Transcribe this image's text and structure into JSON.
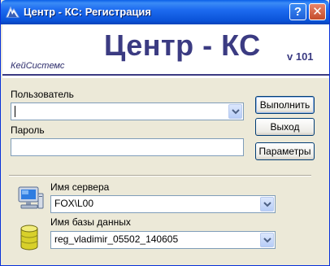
{
  "window": {
    "title": "Центр - КС: Регистрация",
    "help_label": "?",
    "close_label": "✕"
  },
  "banner": {
    "title": "Центр - КС",
    "version": "v 101",
    "company": "КейСистемс"
  },
  "form": {
    "user_label": "Пользователь",
    "user_value": "",
    "password_label": "Пароль",
    "password_value": "",
    "server_label": "Имя сервера",
    "server_value": "FOX\\L00",
    "db_label": "Имя базы данных",
    "db_value": "reg_vladimir_05502_140605"
  },
  "buttons": {
    "execute": "Выполнить",
    "exit": "Выход",
    "params": "Параметры"
  },
  "icons": {
    "server": "computer-icon",
    "database": "database-icon"
  }
}
